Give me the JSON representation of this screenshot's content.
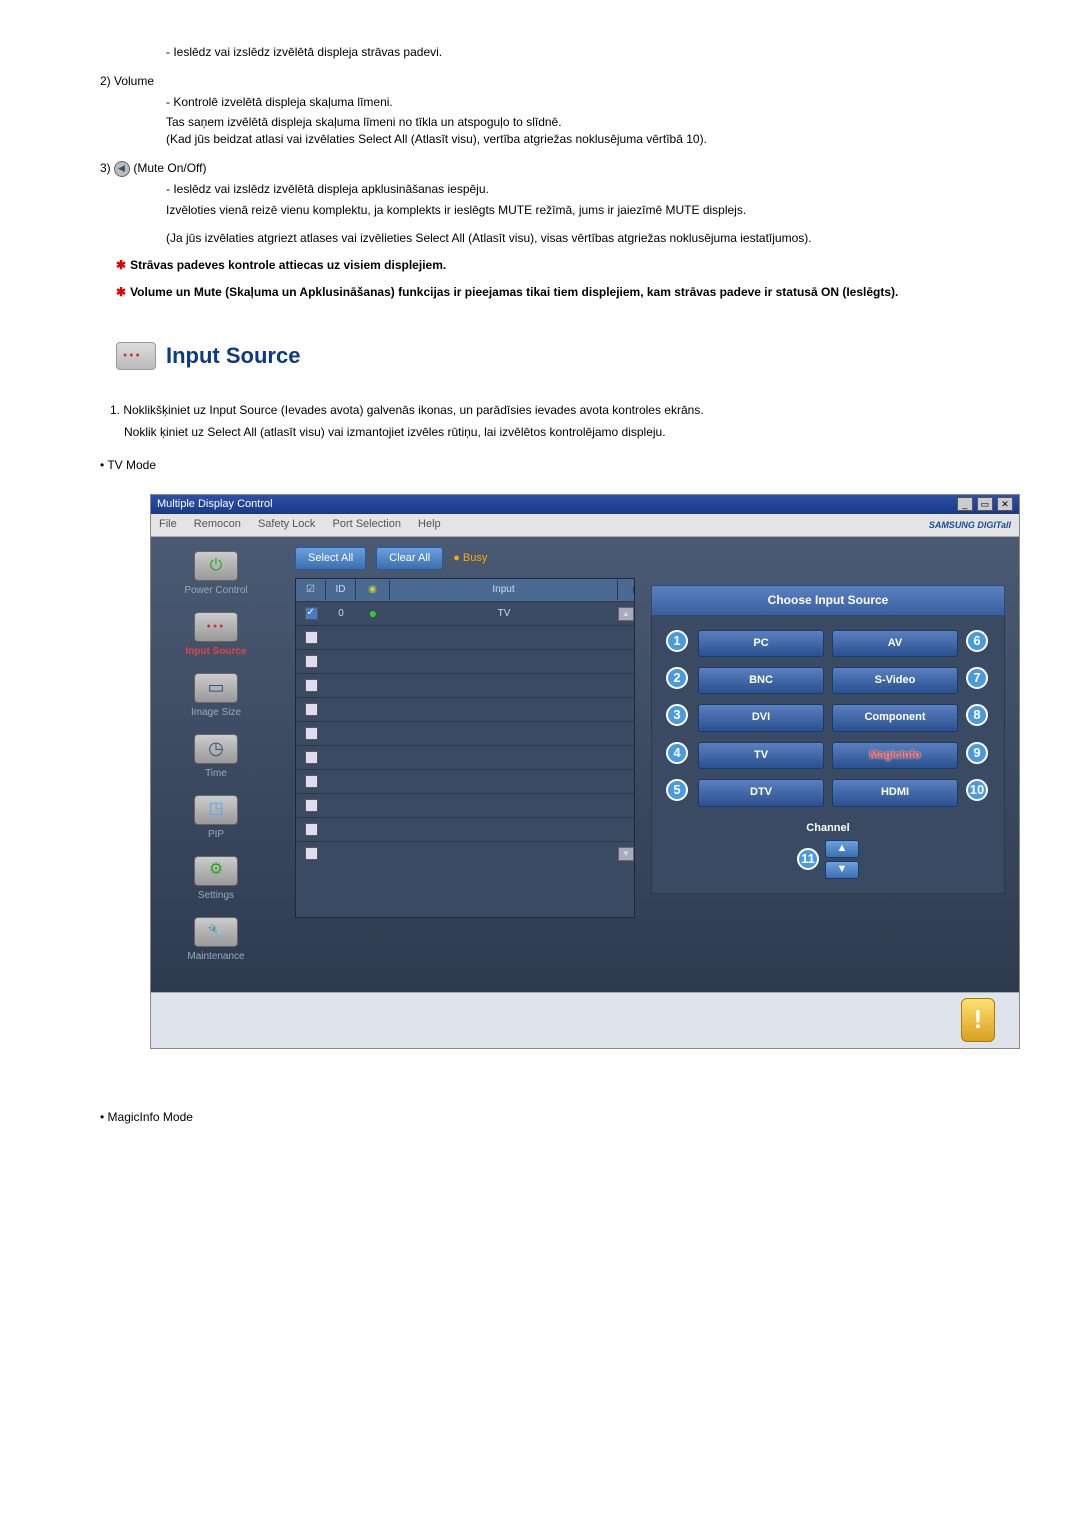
{
  "line_power": "- Ieslēdz vai izslēdz izvēlētā displeja strāvas padevi.",
  "item2": "2)  Volume",
  "vol1": "- Kontrolē izvelētā displeja skaļuma līmeni.",
  "vol2": "Tas saņem izvēlētā displeja skaļuma līmeni no tīkla un atspoguļo to slīdnē.",
  "vol3": "(Kad jūs beidzat atlasi vai izvēlaties Select All (Atlasīt visu), vertība atgriežas noklusējuma vērtībā 10).",
  "item3_prefix": "3)",
  "item3": "(Mute On/Off)",
  "mute1": "- Ieslēdz vai izslēdz izvēlētā displeja apklusināšanas iespēju.",
  "mute2": "Izvēloties vienā reizē vienu komplektu, ja komplekts ir ieslēgts MUTE režīmā, jums ir jaiezīmē MUTE displejs.",
  "mute3": "(Ja jūs izvēlaties atgriezt atlases vai izvēlieties Select All (Atlasīt visu), visas vērtības atgriežas noklusējuma iestatījumos).",
  "star1": "Strāvas padeves kontrole attiecas uz visiem displejiem.",
  "star2": "Volume un Mute (Skaļuma un Apklusināšanas) funkcijas ir pieejamas tikai tiem displejiem, kam strāvas padeve ir statusā ON (Ieslēgts).",
  "heading": "Input Source",
  "ol1": "1.  Noklikšķiniet uz Input Source (Ievades avota) galvenās ikonas, un parādīsies ievades avota kontroles ekrāns.",
  "ol1b": "Noklik    ķiniet uz Select All (atlasīt visu) vai izmantojiet izvēles rūtiņu, lai izvēlētos kontrolējamo displeju.",
  "tvmode": "• TV Mode",
  "screenshot": {
    "title": "Multiple Display Control",
    "menu": {
      "file": "File",
      "remocon": "Remocon",
      "safety": "Safety Lock",
      "port": "Port Selection",
      "help": "Help"
    },
    "brand": "SAMSUNG DIGITall",
    "selectAll": "Select All",
    "clearAll": "Clear All",
    "busy": "Busy",
    "gridHead": {
      "chk": "☑",
      "id": "ID",
      "status": "",
      "input": "Input"
    },
    "row0": {
      "id": "0",
      "input": "TV"
    },
    "nav": {
      "power": "Power Control",
      "input": "Input Source",
      "size": "Image Size",
      "time": "Time",
      "pip": "PIP",
      "settings": "Settings",
      "maint": "Maintenance"
    },
    "chooseTitle": "Choose Input Source",
    "sources": {
      "pc": "PC",
      "av": "AV",
      "bnc": "BNC",
      "svideo": "S-Video",
      "dvi": "DVI",
      "component": "Component",
      "tv": "TV",
      "magicinfo": "MagicInfo",
      "dtv": "DTV",
      "hdmi": "HDMI"
    },
    "nums": {
      "n1": "1",
      "n2": "2",
      "n3": "3",
      "n4": "4",
      "n5": "5",
      "n6": "6",
      "n7": "7",
      "n8": "8",
      "n9": "9",
      "n10": "10",
      "n11": "11"
    },
    "channel": "Channel",
    "info": "!"
  },
  "magicmode": "• MagicInfo Mode"
}
